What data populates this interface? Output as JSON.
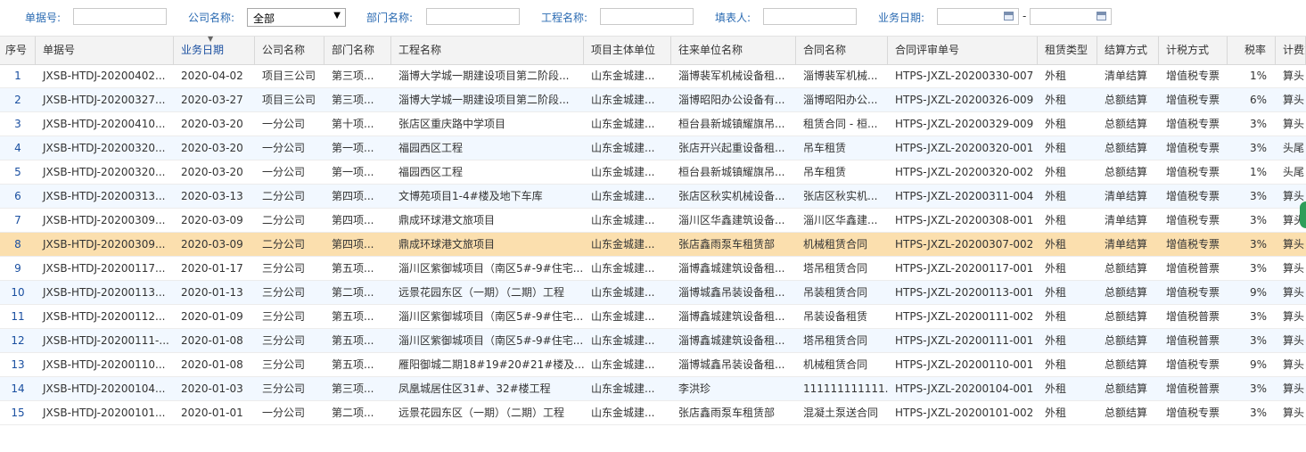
{
  "filters": {
    "doc_no_label": "单据号:",
    "company_label": "公司名称:",
    "company_value": "全部",
    "dept_label": "部门名称:",
    "project_label": "工程名称:",
    "filler_label": "填表人:",
    "biz_date_label": "业务日期:",
    "date_separator": "-"
  },
  "columns": [
    "序号",
    "单据号",
    "业务日期",
    "公司名称",
    "部门名称",
    "工程名称",
    "项目主体单位",
    "往来单位名称",
    "合同名称",
    "合同评审单号",
    "租赁类型",
    "结算方式",
    "计税方式",
    "税率",
    "计费方"
  ],
  "rows": [
    [
      "1",
      "JXSB-HTDJ-20200402...",
      "2020-04-02",
      "项目三公司",
      "第三项...",
      "淄博大学城一期建设项目第二阶段...",
      "山东金城建...",
      "淄博裴军机械设备租...",
      "淄博裴军机械...",
      "HTPS-JXZL-20200330-007",
      "外租",
      "清单结算",
      "增值税专票",
      "1%",
      "算头"
    ],
    [
      "2",
      "JXSB-HTDJ-20200327...",
      "2020-03-27",
      "项目三公司",
      "第三项...",
      "淄博大学城一期建设项目第二阶段...",
      "山东金城建...",
      "淄博昭阳办公设备有...",
      "淄博昭阳办公...",
      "HTPS-JXZL-20200326-009",
      "外租",
      "总额结算",
      "增值税专票",
      "6%",
      "算头"
    ],
    [
      "3",
      "JXSB-HTDJ-20200410...",
      "2020-03-20",
      "一分公司",
      "第十项...",
      "张店区重庆路中学项目",
      "山东金城建...",
      "桓台县新城镇耀旗吊...",
      "租赁合同 - 桓...",
      "HTPS-JXZL-20200329-009",
      "外租",
      "总额结算",
      "增值税专票",
      "3%",
      "算头"
    ],
    [
      "4",
      "JXSB-HTDJ-20200320...",
      "2020-03-20",
      "一分公司",
      "第一项...",
      "福园西区工程",
      "山东金城建...",
      "张店开兴起重设备租...",
      "吊车租赁",
      "HTPS-JXZL-20200320-001",
      "外租",
      "总额结算",
      "增值税专票",
      "3%",
      "头尾"
    ],
    [
      "5",
      "JXSB-HTDJ-20200320...",
      "2020-03-20",
      "一分公司",
      "第一项...",
      "福园西区工程",
      "山东金城建...",
      "桓台县新城镇耀旗吊...",
      "吊车租赁",
      "HTPS-JXZL-20200320-002",
      "外租",
      "总额结算",
      "增值税专票",
      "1%",
      "头尾"
    ],
    [
      "6",
      "JXSB-HTDJ-20200313...",
      "2020-03-13",
      "二分公司",
      "第四项...",
      "文博苑项目1-4#楼及地下车库",
      "山东金城建...",
      "张店区秋实机械设备...",
      "张店区秋实机...",
      "HTPS-JXZL-20200311-004",
      "外租",
      "清单结算",
      "增值税专票",
      "3%",
      "算头"
    ],
    [
      "7",
      "JXSB-HTDJ-20200309...",
      "2020-03-09",
      "二分公司",
      "第四项...",
      "鼎成环球港文旅项目",
      "山东金城建...",
      "淄川区华鑫建筑设备...",
      "淄川区华鑫建...",
      "HTPS-JXZL-20200308-001",
      "外租",
      "清单结算",
      "增值税专票",
      "3%",
      "算头"
    ],
    [
      "8",
      "JXSB-HTDJ-20200309...",
      "2020-03-09",
      "二分公司",
      "第四项...",
      "鼎成环球港文旅项目",
      "山东金城建...",
      "张店鑫雨泵车租赁部",
      "机械租赁合同",
      "HTPS-JXZL-20200307-002",
      "外租",
      "清单结算",
      "增值税专票",
      "3%",
      "算头"
    ],
    [
      "9",
      "JXSB-HTDJ-20200117...",
      "2020-01-17",
      "三分公司",
      "第五项...",
      "淄川区紫御城项目（南区5#-9#住宅...",
      "山东金城建...",
      "淄博鑫城建筑设备租...",
      "塔吊租赁合同",
      "HTPS-JXZL-20200117-001",
      "外租",
      "总额结算",
      "增值税普票",
      "3%",
      "算头"
    ],
    [
      "10",
      "JXSB-HTDJ-20200113...",
      "2020-01-13",
      "三分公司",
      "第二项...",
      "远景花园东区（一期）（二期）工程",
      "山东金城建...",
      "淄博城鑫吊装设备租...",
      "吊装租赁合同",
      "HTPS-JXZL-20200113-001",
      "外租",
      "总额结算",
      "增值税专票",
      "9%",
      "算头"
    ],
    [
      "11",
      "JXSB-HTDJ-20200112...",
      "2020-01-09",
      "三分公司",
      "第五项...",
      "淄川区紫御城项目（南区5#-9#住宅...",
      "山东金城建...",
      "淄博鑫城建筑设备租...",
      "吊装设备租赁",
      "HTPS-JXZL-20200111-002",
      "外租",
      "总额结算",
      "增值税普票",
      "3%",
      "算头"
    ],
    [
      "12",
      "JXSB-HTDJ-20200111-...",
      "2020-01-08",
      "三分公司",
      "第五项...",
      "淄川区紫御城项目（南区5#-9#住宅...",
      "山东金城建...",
      "淄博鑫城建筑设备租...",
      "塔吊租赁合同",
      "HTPS-JXZL-20200111-001",
      "外租",
      "总额结算",
      "增值税普票",
      "3%",
      "算头"
    ],
    [
      "13",
      "JXSB-HTDJ-20200110...",
      "2020-01-08",
      "三分公司",
      "第五项...",
      "雁阳御城二期18#19#20#21#楼及...",
      "山东金城建...",
      "淄博城鑫吊装设备租...",
      "机械租赁合同",
      "HTPS-JXZL-20200110-001",
      "外租",
      "总额结算",
      "增值税专票",
      "9%",
      "算头"
    ],
    [
      "14",
      "JXSB-HTDJ-20200104...",
      "2020-01-03",
      "三分公司",
      "第三项...",
      "凤凰城居住区31#、32#楼工程",
      "山东金城建...",
      "李洪珍",
      "111111111111...",
      "HTPS-JXZL-20200104-001",
      "外租",
      "总额结算",
      "增值税普票",
      "3%",
      "算头"
    ],
    [
      "15",
      "JXSB-HTDJ-20200101...",
      "2020-01-01",
      "一分公司",
      "第二项...",
      "远景花园东区（一期）（二期）工程",
      "山东金城建...",
      "张店鑫雨泵车租赁部",
      "混凝土泵送合同",
      "HTPS-JXZL-20200101-002",
      "外租",
      "总额结算",
      "增值税专票",
      "3%",
      "算头"
    ]
  ],
  "selected_row": 7,
  "colors": {
    "header_bg": "#f3f3f3",
    "alt_row": "#f2f8ff",
    "selected_row": "#fbdfae",
    "link": "#1a4fa0",
    "label": "#2a6ab2"
  },
  "icons": [
    "calendar-icon",
    "chevron-down-icon",
    "sort-indicator-icon"
  ]
}
